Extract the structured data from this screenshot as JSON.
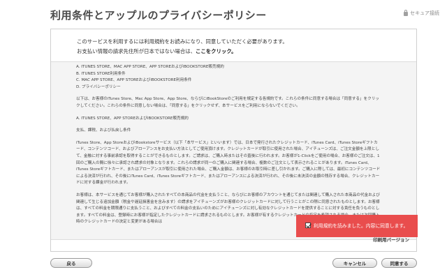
{
  "header": {
    "title": "利用条件とアップルのプライバシーポリシー",
    "secure_label": "セキュア接続"
  },
  "intro": {
    "line1": "このサービスを利用するには利用規約をお読みになり、同意していただく必要があります。",
    "line2_prefix": "お支払い情報の請求先住所が日本ではない場合は、",
    "line2_link": "ここをクリック。"
  },
  "terms": {
    "list": [
      "A. ITUNES STORE、MAC APP STORE、APP STOREおよびIBOOKSTORE販売規約",
      "B. ITUNES STORE利用条件",
      "C. MAC APP STORE、APP STOREおよびIBOOKSTORE利用条件",
      "D. プライバシーポリシー"
    ],
    "para1": "以下は、お客様のiTunes Store、Mac App Store、App Store、ならびにiBookStoreのご利用を規定する各規約です。これらの条件に同意する場合は「同意する」をクリックしてください。これらの条件に同意しない場合は、「同意する」をクリックせず、本サービスをご利用にならないでください。",
    "section_heading": "A. ITUNES STORE、APP STOREおよびIBOOKSTORE販売規約",
    "sub_heading": "支払、課税、および払戻し条件",
    "para2": "iTunes Store、App StoreおよびiBookstoreサービス（以下「本サービス」といいます）では、日本で発行されたクレジットカード、iTunes Card、iTunes Storeギフトカード、コンテンツコード、およびアローアンスをお支払い方法としてご使用頂けます。クレジットカードが取引に使用された場合、アイチューンズは、ご注文金額を上限として、金融に対する事前承認を取得することができるものとします。ご請求は、ご購入時またはその直後に行われます。お客様が1-Clickをご使用の場合、お客様のご注文は、1回のご購入の間に徐々に承認され請求の対象となります。これらの請求が同一のご購入に関連する場合、複数のご注文として表示されることがあります。iTunes Card、iTunes Storeギフトカード、またはアローアンスが取引に使用された場合、ご購入金額は、お客様のお取引時に差し引かれます。ご購入に際しては、最初にコンテンツコードによる決済が行われ、その後にiTunes Card、iTunes Storeギフトカード、またはアローアンスによる決済が行われ、その後に未決済の金額の残存する場合、クレジットカードに対する課金が行われます。",
    "para3": "お客様は、本サービスを通じてお客様が購入されたすべての本商品の代金を支払うこと、ならびにお客様のアカウントを通じてまたは関連して購入された本商品の代金および関連して生じる追加金額（税金や遅延損害金を含みます）の請求をアイチューンズがお客様のクレジットカードに対して行うことがこの際に同意されたものとします。お客様は、すべての料金を期限通りに支払うこと、およびすべての料金の支払いのためにアイチューンズに対し有効なクレジットカードを提供することに対する責任を負うものとします。すべての料金は、登録時にお客様が指定したクレジットカードに請求されるものとします。お客様が有するクレジットカードの指定を希望される場合、または次回購入時のクレジットカードの決定と変更がある場合は"
  },
  "print_link": "印刷用バージョン",
  "agree_checkbox_label": "利用規約を読みました。内容に同意します。",
  "buttons": {
    "back": "戻る",
    "cancel": "キャンセル",
    "agree": "同意する"
  },
  "colors": {
    "highlight": "#e94d4d",
    "panel_bg": "#f4f4f4"
  }
}
